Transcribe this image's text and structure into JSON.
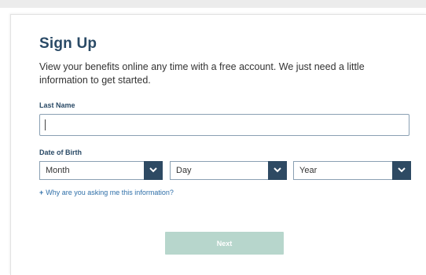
{
  "form": {
    "title": "Sign Up",
    "intro": "View your benefits online any time with a free account. We just need a little information to get started.",
    "last_name": {
      "label": "Last Name",
      "value": "",
      "placeholder": ""
    },
    "dob": {
      "label": "Date of Birth",
      "month": {
        "selected": "Month"
      },
      "day": {
        "selected": "Day"
      },
      "year": {
        "selected": "Year"
      }
    },
    "why_link": {
      "plus": "+",
      "text": "Why are you asking me this information?"
    },
    "next_label": "Next"
  },
  "colors": {
    "title": "#2a4a66",
    "dropdown_arrow_bg": "#2e4a63",
    "link": "#2f6fa8",
    "next_button_bg": "#b7d6cc"
  },
  "icons": {
    "dropdown": "chevron-down-icon"
  }
}
